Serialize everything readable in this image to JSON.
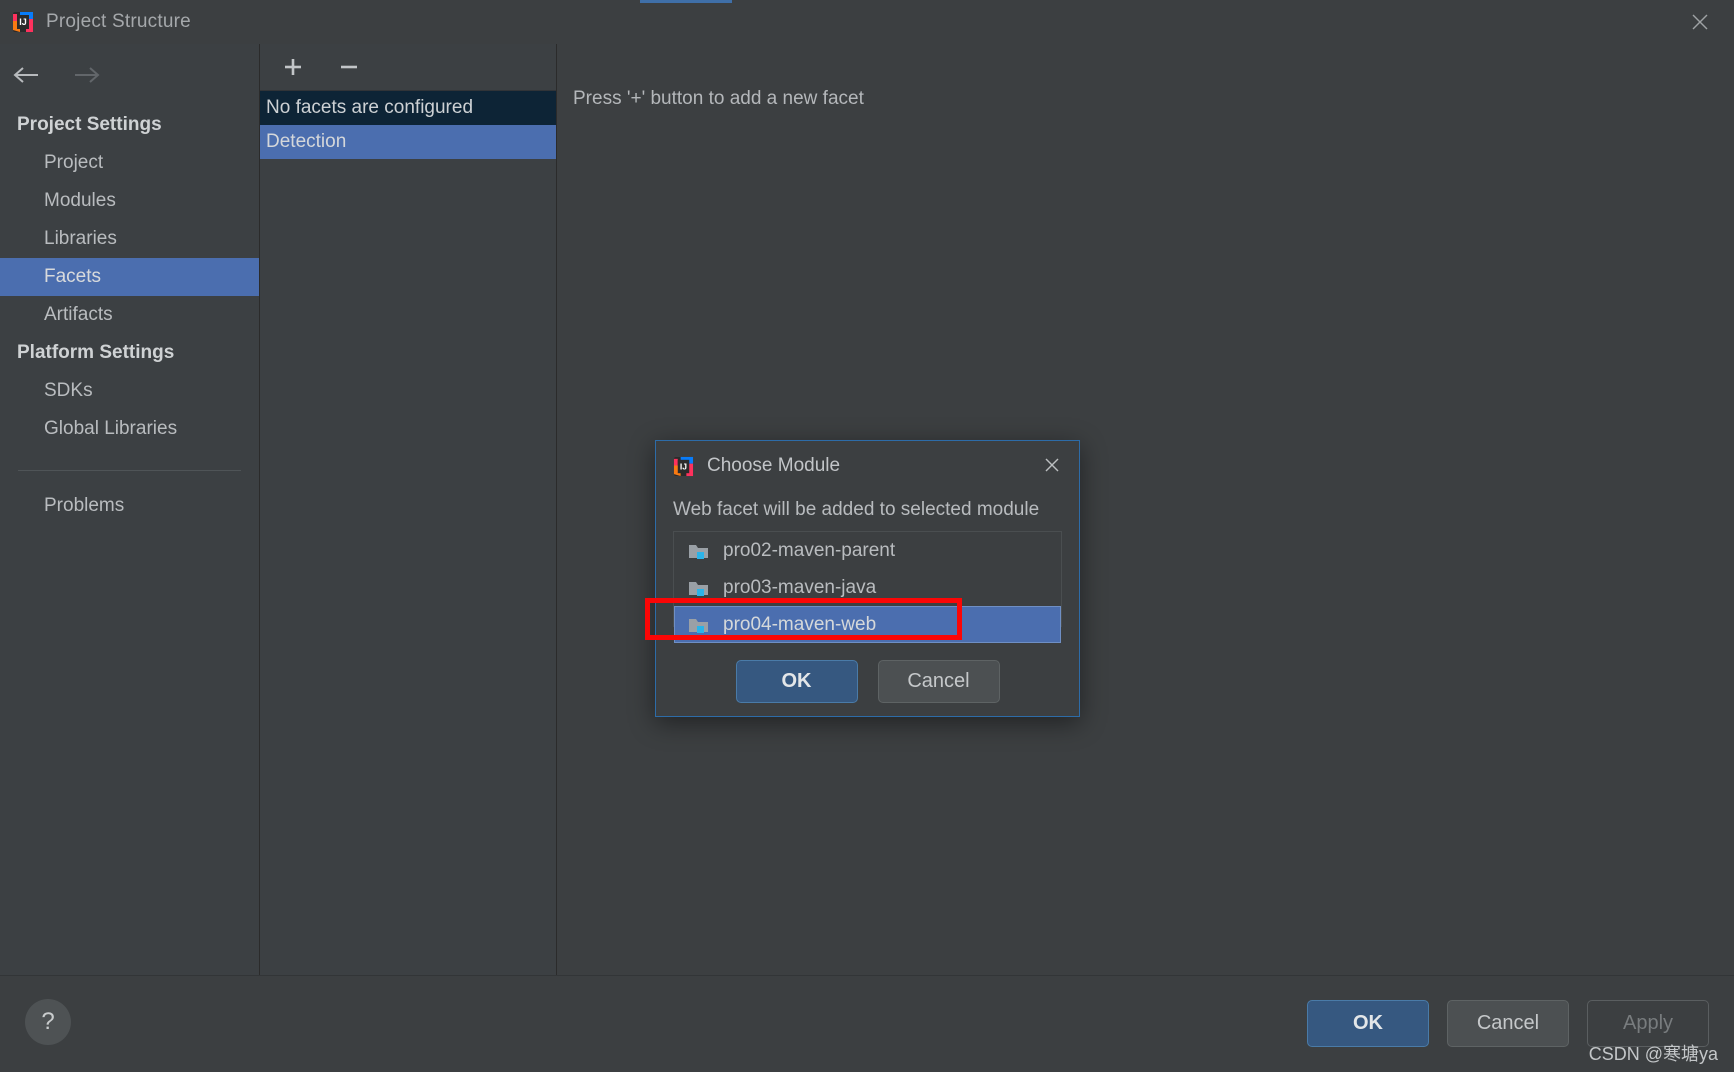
{
  "window": {
    "title": "Project Structure",
    "app_icon": "intellij-idea-icon",
    "close_icon": "close-icon"
  },
  "sidebar": {
    "back_icon": "arrow-left-icon",
    "forward_icon": "arrow-right-icon",
    "groups": [
      {
        "title": "Project Settings",
        "items": [
          {
            "label": "Project",
            "selected": false
          },
          {
            "label": "Modules",
            "selected": false
          },
          {
            "label": "Libraries",
            "selected": false
          },
          {
            "label": "Facets",
            "selected": true
          },
          {
            "label": "Artifacts",
            "selected": false
          }
        ]
      },
      {
        "title": "Platform Settings",
        "items": [
          {
            "label": "SDKs",
            "selected": false
          },
          {
            "label": "Global Libraries",
            "selected": false
          }
        ]
      }
    ],
    "problems": {
      "label": "Problems"
    }
  },
  "facets_panel": {
    "toolbar": {
      "add_label": "+",
      "add_icon": "plus-icon",
      "remove_label": "−",
      "remove_icon": "minus-icon"
    },
    "rows": [
      {
        "label": "No facets are configured",
        "style": "header"
      },
      {
        "label": "Detection",
        "style": "selected"
      }
    ]
  },
  "right_pane": {
    "hint": "Press '+' button to add a new facet"
  },
  "modal": {
    "icon": "intellij-idea-icon",
    "title": "Choose Module",
    "close_icon": "close-icon",
    "subtitle": "Web facet will be added to selected module",
    "modules": [
      {
        "label": "pro02-maven-parent",
        "icon": "module-folder-icon",
        "selected": false
      },
      {
        "label": "pro03-maven-java",
        "icon": "module-folder-icon",
        "selected": false
      },
      {
        "label": "pro04-maven-web",
        "icon": "module-folder-icon",
        "selected": true
      }
    ],
    "ok_label": "OK",
    "cancel_label": "Cancel"
  },
  "bottom_bar": {
    "help_label": "?",
    "help_icon": "help-icon",
    "ok_label": "OK",
    "cancel_label": "Cancel",
    "apply_label": "Apply"
  },
  "watermark": "CSDN @寒塘ya",
  "colors": {
    "window_bg": "#3c3f41",
    "sidebar_bg": "#3c4043",
    "selection_blue": "#4b6eaf",
    "header_dark_blue": "#0d2436",
    "primary_button": "#365880",
    "modal_border": "#2d6ca8",
    "annotation_red": "#fb0606"
  }
}
